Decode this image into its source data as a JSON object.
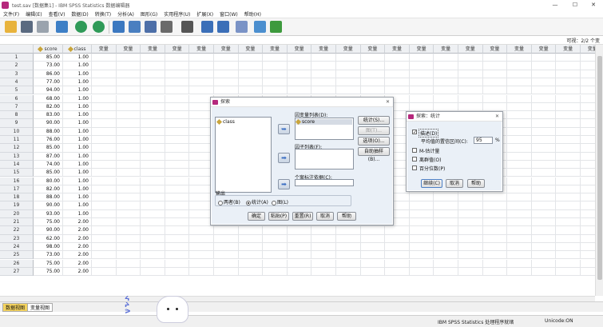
{
  "window": {
    "title": "test.sav [数据集1] - IBM SPSS Statistics 数据编辑器",
    "minimize": "—",
    "maximize": "☐",
    "close": "✕"
  },
  "menu": [
    "文件(F)",
    "编辑(E)",
    "查看(V)",
    "数据(D)",
    "转换(T)",
    "分析(A)",
    "图形(G)",
    "实用程序(U)",
    "扩展(X)",
    "窗口(W)",
    "帮助(H)"
  ],
  "visible_label": "可视：2/2 个变",
  "grid": {
    "columns": [
      "score",
      "class",
      "变量",
      "变量",
      "变量",
      "变量",
      "变量",
      "变量",
      "变量",
      "变量",
      "变量",
      "变量",
      "变量",
      "变量",
      "变量",
      "变量",
      "变量",
      "变量",
      "变量",
      "变量",
      "变量",
      "变量",
      "变量"
    ],
    "rows": [
      [
        "1",
        "85.00",
        "1.00"
      ],
      [
        "2",
        "73.00",
        "1.00"
      ],
      [
        "3",
        "86.00",
        "1.00"
      ],
      [
        "4",
        "77.00",
        "1.00"
      ],
      [
        "5",
        "94.00",
        "1.00"
      ],
      [
        "6",
        "68.00",
        "1.00"
      ],
      [
        "7",
        "82.00",
        "1.00"
      ],
      [
        "8",
        "83.00",
        "1.00"
      ],
      [
        "9",
        "90.00",
        "1.00"
      ],
      [
        "10",
        "88.00",
        "1.00"
      ],
      [
        "11",
        "76.00",
        "1.00"
      ],
      [
        "12",
        "85.00",
        "1.00"
      ],
      [
        "13",
        "87.00",
        "1.00"
      ],
      [
        "14",
        "74.00",
        "1.00"
      ],
      [
        "15",
        "85.00",
        "1.00"
      ],
      [
        "16",
        "80.00",
        "1.00"
      ],
      [
        "17",
        "82.00",
        "1.00"
      ],
      [
        "18",
        "88.00",
        "1.00"
      ],
      [
        "19",
        "90.00",
        "1.00"
      ],
      [
        "20",
        "93.00",
        "1.00"
      ],
      [
        "21",
        "75.00",
        "2.00"
      ],
      [
        "22",
        "90.00",
        "2.00"
      ],
      [
        "23",
        "62.00",
        "2.00"
      ],
      [
        "24",
        "98.00",
        "2.00"
      ],
      [
        "25",
        "73.00",
        "2.00"
      ],
      [
        "26",
        "75.00",
        "2.00"
      ],
      [
        "27",
        "75.00",
        "2.00"
      ]
    ]
  },
  "tabs": {
    "data_view": "数据视图",
    "variable_view": "变量视图"
  },
  "status": {
    "processor": "IBM SPSS Statistics 处理程序就绪",
    "unicode": "Unicode:ON"
  },
  "explore_dialog": {
    "title": "探索",
    "source_var": "class",
    "dependent_label": "因变量列表(D):",
    "dependent_item": "score",
    "factor_label": "因子列表(F):",
    "label_cases": "个案标注依据(C):",
    "buttons": {
      "statistics": "统计(S)...",
      "plots": "图(T)...",
      "options": "选项(O)...",
      "bootstrap": "自助抽样(B)..."
    },
    "output_label": "输出",
    "output_options": [
      "两者(B)",
      "统计(A)",
      "图(L)"
    ],
    "output_selected": 1,
    "footer": [
      "确定",
      "粘贴(P)",
      "重置(R)",
      "取消",
      "帮助"
    ]
  },
  "stats_dialog": {
    "title": "探索：统计",
    "descriptives": "描述(D)",
    "ci_label": "平均值的置信区间(C):",
    "ci_value": "95",
    "ci_unit": "%",
    "m_estimators": "M-估计量",
    "outliers": "离群值(O)",
    "percentiles": "百分位数(P)",
    "footer": [
      "继续(C)",
      "取消",
      "帮助"
    ]
  }
}
